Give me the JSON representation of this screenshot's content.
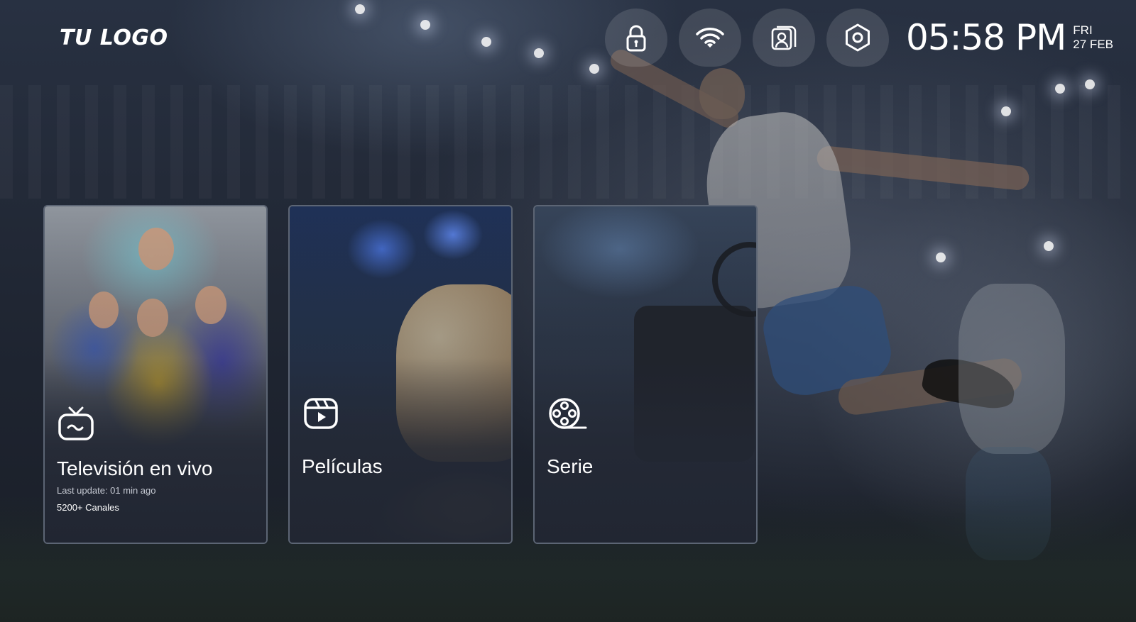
{
  "brand": {
    "logo_text": "TU LOGO"
  },
  "topbar": {
    "icons": [
      {
        "name": "lock-icon"
      },
      {
        "name": "wifi-icon"
      },
      {
        "name": "profile-icon"
      },
      {
        "name": "settings-icon"
      }
    ],
    "time": "05:58 PM",
    "weekday": "FRI",
    "date": "27 FEB"
  },
  "cards": [
    {
      "id": "live-tv",
      "icon": "tv-icon",
      "title": "Televisión en vivo",
      "last_update": "Last update: 01 min ago",
      "channels": "5200+ Canales"
    },
    {
      "id": "movies",
      "icon": "play-video-icon",
      "title": "Películas"
    },
    {
      "id": "series",
      "icon": "film-reel-icon",
      "title": "Serie"
    }
  ],
  "colors": {
    "background": "#1b1f2a",
    "card_bg": "#262c38",
    "card_border": "#a0aabe",
    "text": "#ffffff",
    "muted_text": "#c6cad3"
  }
}
